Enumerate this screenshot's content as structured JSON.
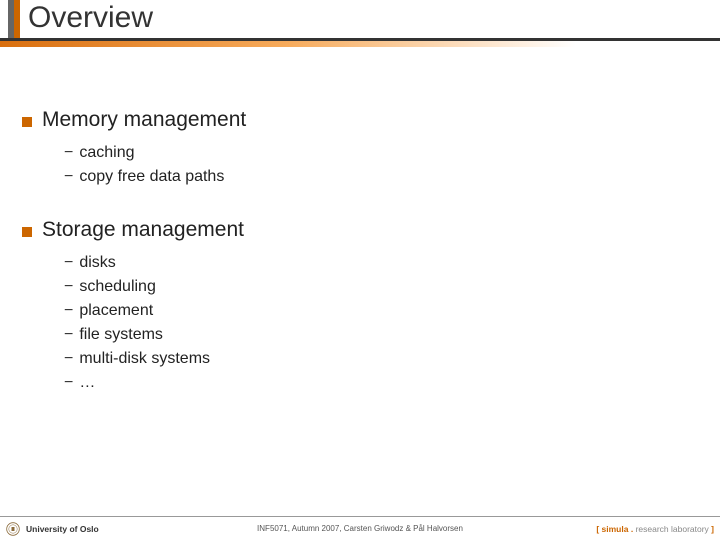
{
  "title": "Overview",
  "sections": [
    {
      "heading": "Memory management",
      "items": [
        "caching",
        "copy free data paths"
      ]
    },
    {
      "heading": "Storage management",
      "items": [
        "disks",
        "scheduling",
        "placement",
        "file systems",
        "multi-disk systems",
        "…"
      ]
    }
  ],
  "footer": {
    "left": "University of Oslo",
    "center": "INF5071, Autumn 2007, Carsten Griwodz & Pål Halvorsen",
    "right_brand": "simula",
    "right_suffix": "research laboratory"
  }
}
